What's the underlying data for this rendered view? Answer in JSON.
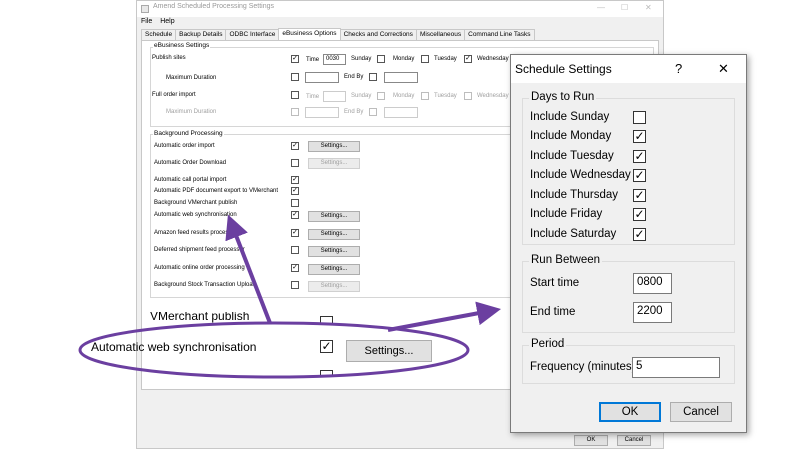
{
  "window": {
    "title": "Amend Scheduled Processing Settings",
    "minimize": "—",
    "maximize": "☐",
    "close": "✕",
    "menu": [
      "File",
      "Help"
    ],
    "tabs": [
      "Schedule",
      "Backup Details",
      "ODBC Interface",
      "eBusiness Options",
      "Checks and Corrections",
      "Miscellaneous",
      "Command Line Tasks"
    ],
    "active_tab": "eBusiness Options",
    "ok_label": "OK",
    "cancel_label": "Cancel"
  },
  "ebusiness": {
    "group_label": "eBusiness Settings",
    "publish_sites": {
      "label": "Publish sites",
      "checked": true,
      "time_label": "Time",
      "time_value": "0030",
      "days": [
        "Sunday",
        "Monday",
        "Tuesday",
        "Wednesday"
      ],
      "days_checked": [
        false,
        false,
        true,
        true
      ],
      "max_duration_label": "Maximum Duration",
      "end_by_label": "End By"
    },
    "full_order_import": {
      "label": "Full order import",
      "checked": false,
      "time_label": "Time",
      "days": [
        "Sunday",
        "Monday",
        "Tuesday",
        "Wednesday"
      ],
      "max_duration_label": "Maximum Duration",
      "end_by_label": "End By"
    }
  },
  "background": {
    "group_label": "Background Processing",
    "settings_label": "Settings...",
    "items": [
      {
        "label": "Automatic order import",
        "checked": true,
        "button": true,
        "button_enabled": true
      },
      {
        "label": "Automatic Order Download",
        "checked": false,
        "button": true,
        "button_enabled": false
      },
      {
        "label": "Automatic call portal import",
        "checked": true,
        "button": false
      },
      {
        "label": "Automatic PDF document export to VMerchant",
        "checked": true,
        "button": false
      },
      {
        "label": "Background VMerchant publish",
        "checked": false,
        "button": false
      },
      {
        "label": "Automatic web synchronisation",
        "checked": true,
        "button": true,
        "button_enabled": true
      },
      {
        "label": "Amazon feed results processor",
        "checked": true,
        "button": true,
        "button_enabled": true
      },
      {
        "label": "Deferred shipment feed processor",
        "checked": false,
        "button": true,
        "button_enabled": true
      },
      {
        "label": "Automatic online order processing",
        "checked": true,
        "button": true,
        "button_enabled": true
      },
      {
        "label": "Background Stock Transaction Upload",
        "checked": false,
        "button": true,
        "button_enabled": false
      }
    ]
  },
  "zoom": {
    "partial_label": "VMerchant publish",
    "label": "Automatic web synchronisation",
    "checked": true,
    "button_label": "Settings..."
  },
  "dialog": {
    "title": "Schedule Settings",
    "help": "?",
    "close": "✕",
    "days_group": "Days to Run",
    "days": [
      {
        "label": "Include Sunday",
        "checked": false
      },
      {
        "label": "Include Monday",
        "checked": true
      },
      {
        "label": "Include Tuesday",
        "checked": true
      },
      {
        "label": "Include Wednesday",
        "checked": true
      },
      {
        "label": "Include Thursday",
        "checked": true
      },
      {
        "label": "Include Friday",
        "checked": true
      },
      {
        "label": "Include Saturday",
        "checked": true
      }
    ],
    "run_group": "Run Between",
    "start_label": "Start time",
    "start_value": "0800",
    "end_label": "End time",
    "end_value": "2200",
    "period_group": "Period",
    "frequency_label": "Frequency (minutes)",
    "frequency_value": "5",
    "ok_label": "OK",
    "cancel_label": "Cancel"
  },
  "colors": {
    "annotation": "#6b3fa0",
    "dialog_default_border": "#0078d7"
  }
}
